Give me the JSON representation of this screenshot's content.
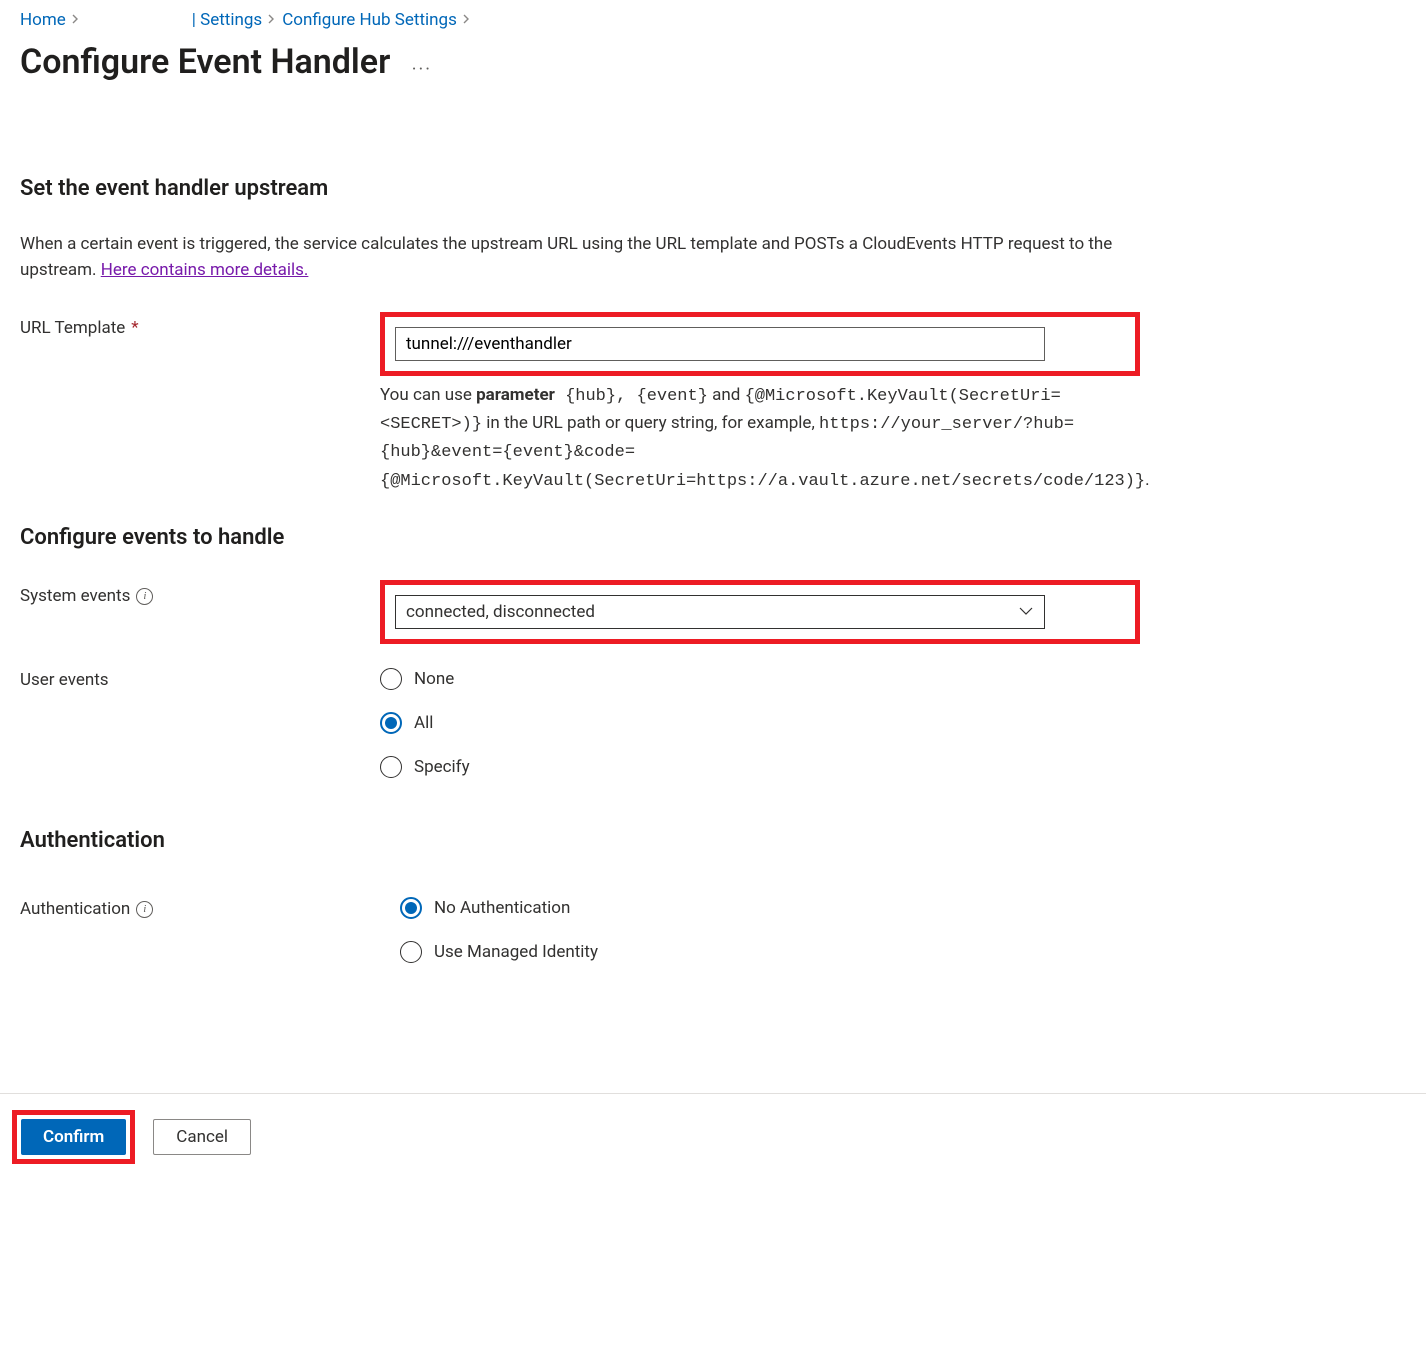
{
  "breadcrumb": {
    "home": "Home",
    "settings": "| Settings",
    "configure_hub": "Configure Hub Settings"
  },
  "page": {
    "title": "Configure Event Handler"
  },
  "sections": {
    "upstream": {
      "heading": "Set the event handler upstream",
      "desc_prefix": "When a certain event is triggered, the service calculates the upstream URL using the URL template and POSTs a CloudEvents HTTP request to the upstream. ",
      "desc_link": "Here contains more details."
    },
    "events": {
      "heading": "Configure events to handle"
    },
    "auth": {
      "heading": "Authentication"
    }
  },
  "fields": {
    "url_template": {
      "label": "URL Template",
      "value": "tunnel:///eventhandler",
      "hint_pref": "You can use ",
      "hint_param": "parameter",
      "hint_seg1": " {hub}, {event}",
      "hint_seg2": " and ",
      "hint_seg3": "{@Microsoft.KeyVault(SecretUri=<SECRET>)}",
      "hint_seg4": " in the URL path or query string, for example, ",
      "hint_seg5": "https://your_server/?hub={hub}&event={event}&code={@Microsoft.KeyVault(SecretUri=https://a.vault.azure.net/secrets/code/123)}",
      "hint_end": "."
    },
    "system_events": {
      "label": "System events",
      "value": "connected, disconnected"
    },
    "user_events": {
      "label": "User events",
      "options": {
        "none": "None",
        "all": "All",
        "specify": "Specify"
      }
    },
    "authentication": {
      "label": "Authentication",
      "options": {
        "no_auth": "No Authentication",
        "managed": "Use Managed Identity"
      }
    }
  },
  "footer": {
    "confirm": "Confirm",
    "cancel": "Cancel"
  }
}
